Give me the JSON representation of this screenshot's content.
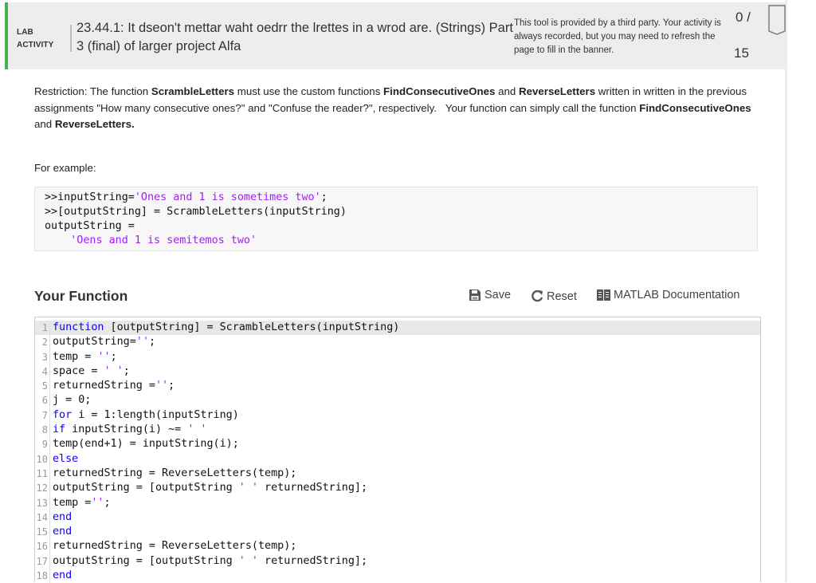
{
  "header": {
    "activity_type_line1": "LAB",
    "activity_type_line2": "ACTIVITY",
    "title": "23.44.1: It dseon't mettar waht oedrr the lrettes in a wrod are. (Strings) Part 3 (final) of larger project Alfa",
    "third_party_notice": "This tool is provided by a third party. Your activity is always recorded, but you may need to refresh the page to fill in the banner.",
    "score_earned": "0 /",
    "score_total": "15",
    "accent_color": "#4caf50"
  },
  "instructions": {
    "p1_a": "Restriction: The function ",
    "p1_b": "ScrambleLetters",
    "p1_c": " must use the custom functions ",
    "p1_d": "FindConsecutiveOnes",
    "p1_e": " and ",
    "p1_f": "ReverseLetters",
    "p1_g": " written in written in the previous assignments \"How many consecutive ones?\" and \"Confuse the reader?\", respectively.   Your function can simply call the function ",
    "p1_h": "FindConsecutiveOnes",
    "p1_i": " and ",
    "p1_j": "ReverseLetters.",
    "for_example": "For example:"
  },
  "example": {
    "l1_prefix": ">>inputString=",
    "l1_str": "'Ones and 1 is sometimes two'",
    "l1_suffix": ";",
    "l2": ">>[outputString] = ScrambleLetters(inputString)",
    "l3": "outputString =",
    "l4_indent": "    ",
    "l4_str": "'Oens and 1 is semitemos two'"
  },
  "section": {
    "title": "Your Function",
    "save_label": "Save",
    "reset_label": "Reset",
    "docs_label": "MATLAB Documentation"
  },
  "code": {
    "lines": [
      {
        "n": "1",
        "t": [
          {
            "k": "kw",
            "v": "function"
          },
          {
            "k": "",
            "v": " [outputString] = ScrambleLetters(inputString)"
          }
        ]
      },
      {
        "n": "2",
        "t": [
          {
            "k": "",
            "v": "outputString="
          },
          {
            "k": "s",
            "v": "''"
          },
          {
            "k": "",
            "v": ";"
          }
        ]
      },
      {
        "n": "3",
        "t": [
          {
            "k": "",
            "v": "temp = "
          },
          {
            "k": "s",
            "v": "''"
          },
          {
            "k": "",
            "v": ";"
          }
        ]
      },
      {
        "n": "4",
        "t": [
          {
            "k": "",
            "v": "space = "
          },
          {
            "k": "s",
            "v": "' '"
          },
          {
            "k": "",
            "v": ";"
          }
        ]
      },
      {
        "n": "5",
        "t": [
          {
            "k": "",
            "v": "returnedString ="
          },
          {
            "k": "s",
            "v": "''"
          },
          {
            "k": "",
            "v": ";"
          }
        ]
      },
      {
        "n": "6",
        "t": [
          {
            "k": "",
            "v": "j = 0;"
          }
        ]
      },
      {
        "n": "7",
        "t": [
          {
            "k": "kw",
            "v": "for"
          },
          {
            "k": "",
            "v": " i = 1:length(inputString)"
          }
        ]
      },
      {
        "n": "8",
        "t": [
          {
            "k": "kw",
            "v": "if"
          },
          {
            "k": "",
            "v": " inputString(i) ~= "
          },
          {
            "k": "s",
            "v": "' '"
          }
        ]
      },
      {
        "n": "9",
        "t": [
          {
            "k": "",
            "v": "temp(end+1) = inputString(i);"
          }
        ]
      },
      {
        "n": "10",
        "t": [
          {
            "k": "kw",
            "v": "else"
          }
        ]
      },
      {
        "n": "11",
        "t": [
          {
            "k": "",
            "v": "returnedString = ReverseLetters(temp);"
          }
        ]
      },
      {
        "n": "12",
        "t": [
          {
            "k": "",
            "v": "outputString = [outputString "
          },
          {
            "k": "s",
            "v": "' '"
          },
          {
            "k": "",
            "v": " returnedString];"
          }
        ]
      },
      {
        "n": "13",
        "t": [
          {
            "k": "",
            "v": "temp ="
          },
          {
            "k": "s",
            "v": "''"
          },
          {
            "k": "",
            "v": ";"
          }
        ]
      },
      {
        "n": "14",
        "t": [
          {
            "k": "kw",
            "v": "end"
          }
        ]
      },
      {
        "n": "15",
        "t": [
          {
            "k": "kw",
            "v": "end"
          }
        ]
      },
      {
        "n": "16",
        "t": [
          {
            "k": "",
            "v": "returnedString = ReverseLetters(temp);"
          }
        ]
      },
      {
        "n": "17",
        "t": [
          {
            "k": "",
            "v": "outputString = [outputString "
          },
          {
            "k": "s",
            "v": "' '"
          },
          {
            "k": "",
            "v": " returnedString];"
          }
        ]
      },
      {
        "n": "18",
        "t": [
          {
            "k": "kw",
            "v": "end"
          }
        ]
      }
    ]
  }
}
